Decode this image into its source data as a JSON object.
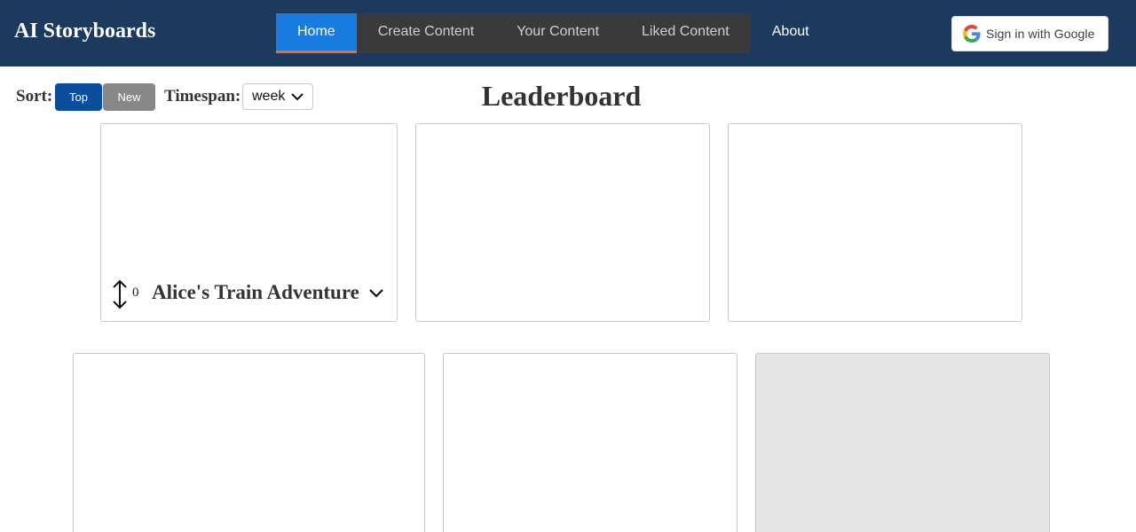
{
  "header": {
    "brand": "AI Storyboards",
    "nav": [
      {
        "label": "Home",
        "active": true
      },
      {
        "label": "Create Content",
        "active": false
      },
      {
        "label": "Your Content",
        "active": false
      },
      {
        "label": "Liked Content",
        "active": false
      },
      {
        "label": "About",
        "active": false
      }
    ],
    "sign_in_label": "Sign in with Google"
  },
  "controls": {
    "sort_label": "Sort:",
    "sort_options": [
      "Top",
      "New"
    ],
    "sort_selected": "Top",
    "timespan_label": "Timespan:",
    "timespan_value": "week"
  },
  "page_title": "Leaderboard",
  "cards": [
    {
      "title": "Alice's Train Adventure",
      "votes": "0"
    },
    {},
    {},
    {},
    {},
    {}
  ],
  "colors": {
    "header_bg": "#1b3a5e",
    "nav_active": "#1a7be0",
    "nav_active_underline": "#f26a1b",
    "sort_top": "#0a4d9c",
    "sort_new": "#888888"
  }
}
